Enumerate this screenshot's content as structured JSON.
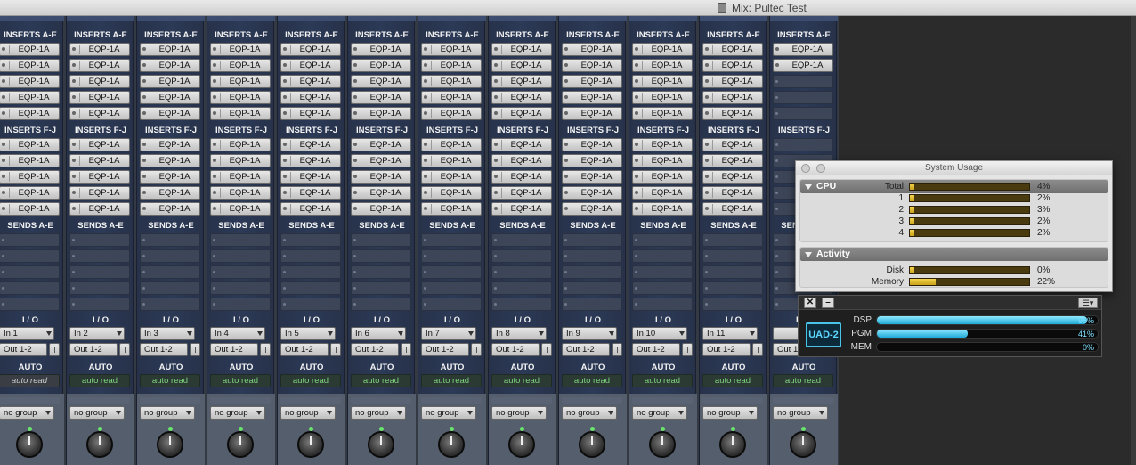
{
  "window": {
    "title": "Mix: Pultec Test"
  },
  "sections": {
    "inserts_ae": "INSERTS A-E",
    "inserts_fj": "INSERTS F-J",
    "sends_ae": "SENDS A-E",
    "io": "I / O",
    "auto": "AUTO"
  },
  "strips": [
    {
      "label_in": "In 1",
      "label_out": "Out 1-2",
      "auto": "auto read",
      "group": "no group",
      "inserts": [
        "EQP-1A",
        "EQP-1A",
        "EQP-1A",
        "EQP-1A",
        "EQP-1A",
        "EQP-1A",
        "EQP-1A",
        "EQP-1A",
        "EQP-1A",
        "EQP-1A"
      ]
    },
    {
      "label_in": "In 2",
      "label_out": "Out 1-2",
      "auto": "auto read",
      "group": "no group",
      "inserts": [
        "EQP-1A",
        "EQP-1A",
        "EQP-1A",
        "EQP-1A",
        "EQP-1A",
        "EQP-1A",
        "EQP-1A",
        "EQP-1A",
        "EQP-1A",
        "EQP-1A"
      ]
    },
    {
      "label_in": "In 3",
      "label_out": "Out 1-2",
      "auto": "auto read",
      "group": "no group",
      "inserts": [
        "EQP-1A",
        "EQP-1A",
        "EQP-1A",
        "EQP-1A",
        "EQP-1A",
        "EQP-1A",
        "EQP-1A",
        "EQP-1A",
        "EQP-1A",
        "EQP-1A"
      ]
    },
    {
      "label_in": "In 4",
      "label_out": "Out 1-2",
      "auto": "auto read",
      "group": "no group",
      "inserts": [
        "EQP-1A",
        "EQP-1A",
        "EQP-1A",
        "EQP-1A",
        "EQP-1A",
        "EQP-1A",
        "EQP-1A",
        "EQP-1A",
        "EQP-1A",
        "EQP-1A"
      ]
    },
    {
      "label_in": "In 5",
      "label_out": "Out 1-2",
      "auto": "auto read",
      "group": "no group",
      "inserts": [
        "EQP-1A",
        "EQP-1A",
        "EQP-1A",
        "EQP-1A",
        "EQP-1A",
        "EQP-1A",
        "EQP-1A",
        "EQP-1A",
        "EQP-1A",
        "EQP-1A"
      ]
    },
    {
      "label_in": "In 6",
      "label_out": "Out 1-2",
      "auto": "auto read",
      "group": "no group",
      "inserts": [
        "EQP-1A",
        "EQP-1A",
        "EQP-1A",
        "EQP-1A",
        "EQP-1A",
        "EQP-1A",
        "EQP-1A",
        "EQP-1A",
        "EQP-1A",
        "EQP-1A"
      ]
    },
    {
      "label_in": "In 7",
      "label_out": "Out 1-2",
      "auto": "auto read",
      "group": "no group",
      "inserts": [
        "EQP-1A",
        "EQP-1A",
        "EQP-1A",
        "EQP-1A",
        "EQP-1A",
        "EQP-1A",
        "EQP-1A",
        "EQP-1A",
        "EQP-1A",
        "EQP-1A"
      ]
    },
    {
      "label_in": "In 8",
      "label_out": "Out 1-2",
      "auto": "auto read",
      "group": "no group",
      "inserts": [
        "EQP-1A",
        "EQP-1A",
        "EQP-1A",
        "EQP-1A",
        "EQP-1A",
        "EQP-1A",
        "EQP-1A",
        "EQP-1A",
        "EQP-1A",
        "EQP-1A"
      ]
    },
    {
      "label_in": "In 9",
      "label_out": "Out 1-2",
      "auto": "auto read",
      "group": "no group",
      "inserts": [
        "EQP-1A",
        "EQP-1A",
        "EQP-1A",
        "EQP-1A",
        "EQP-1A",
        "EQP-1A",
        "EQP-1A",
        "EQP-1A",
        "EQP-1A",
        "EQP-1A"
      ]
    },
    {
      "label_in": "In 10",
      "label_out": "Out 1-2",
      "auto": "auto read",
      "group": "no group",
      "inserts": [
        "EQP-1A",
        "EQP-1A",
        "EQP-1A",
        "EQP-1A",
        "EQP-1A",
        "EQP-1A",
        "EQP-1A",
        "EQP-1A",
        "EQP-1A",
        "EQP-1A"
      ]
    },
    {
      "label_in": "In 11",
      "label_out": "Out 1-2",
      "auto": "auto read",
      "group": "no group",
      "inserts": [
        "EQP-1A",
        "EQP-1A",
        "EQP-1A",
        "EQP-1A",
        "EQP-1A",
        "EQP-1A",
        "EQP-1A",
        "EQP-1A",
        "EQP-1A",
        "EQP-1A"
      ]
    },
    {
      "label_in": "",
      "label_out": "Out 1-2",
      "auto": "auto read",
      "group": "no group",
      "inserts": [
        "EQP-1A",
        "EQP-1A",
        "",
        "",
        "",
        "",
        "",
        "",
        "",
        ""
      ]
    }
  ],
  "system_usage": {
    "title": "System Usage",
    "cpu_header": "CPU",
    "cpu": [
      {
        "label": "Total",
        "value": "4%",
        "fraction": 0.04
      },
      {
        "label": "1",
        "value": "2%",
        "fraction": 0.02
      },
      {
        "label": "2",
        "value": "3%",
        "fraction": 0.03
      },
      {
        "label": "3",
        "value": "2%",
        "fraction": 0.02
      },
      {
        "label": "4",
        "value": "2%",
        "fraction": 0.02
      }
    ],
    "activity_header": "Activity",
    "activity": [
      {
        "label": "Disk",
        "value": "0%",
        "fraction": 0.0
      },
      {
        "label": "Memory",
        "value": "22%",
        "fraction": 0.22
      }
    ]
  },
  "uad": {
    "close_label": "✕",
    "minimize_label": "–",
    "menu_label": "☰▾",
    "logo": "UAD-2",
    "meters": [
      {
        "label": "DSP",
        "value": "95%",
        "fraction": 0.95
      },
      {
        "label": "PGM",
        "value": "41%",
        "fraction": 0.41
      },
      {
        "label": "MEM",
        "value": "0%",
        "fraction": 0.0
      }
    ]
  },
  "colors": {
    "accent_meter": "#1ea9d6",
    "cpu_bar": "#f4d44a",
    "auto_text": "#7fd37f"
  }
}
